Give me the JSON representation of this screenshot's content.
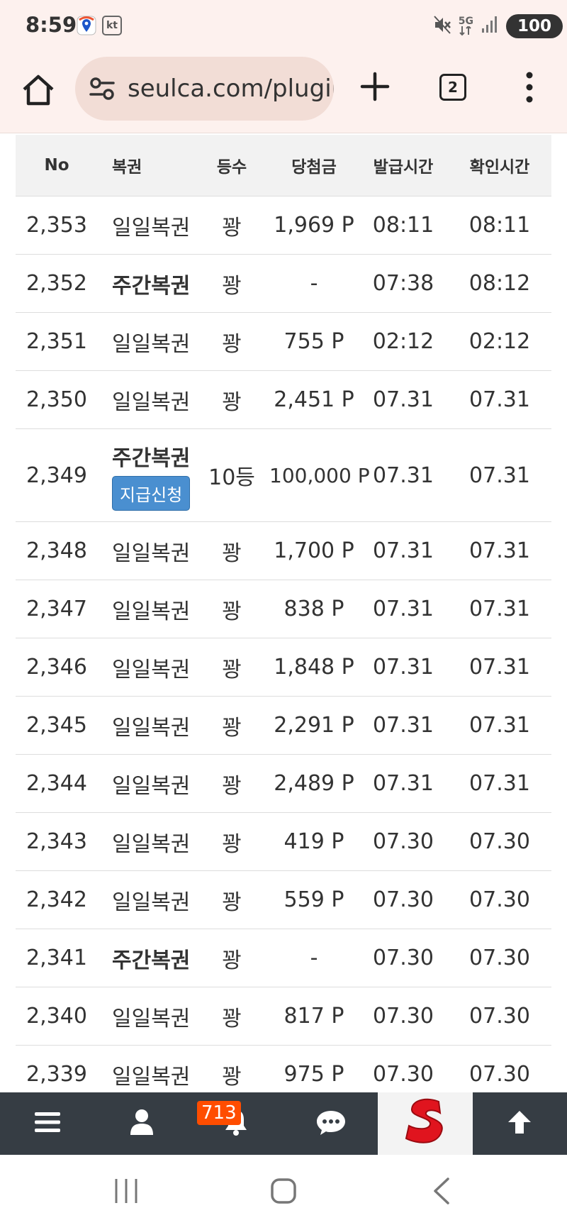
{
  "status_bar": {
    "time": "8:59",
    "carrier": "kt",
    "network": "5G",
    "battery": "100"
  },
  "browser": {
    "url": "seulca.com/plugin",
    "tab_count": "2"
  },
  "table": {
    "headers": [
      "No",
      "복권",
      "등수",
      "당첨금",
      "발급시간",
      "확인시간"
    ],
    "rows": [
      {
        "no": "2,353",
        "name": "일일복권",
        "rank": "꽝",
        "prize": "1,969 P",
        "issued": "08:11",
        "checked": "08:11"
      },
      {
        "no": "2,352",
        "name": "주간복권",
        "rank": "꽝",
        "prize": "-",
        "issued": "07:38",
        "checked": "08:12"
      },
      {
        "no": "2,351",
        "name": "일일복권",
        "rank": "꽝",
        "prize": "755 P",
        "issued": "02:12",
        "checked": "02:12"
      },
      {
        "no": "2,350",
        "name": "일일복권",
        "rank": "꽝",
        "prize": "2,451 P",
        "issued": "07.31",
        "checked": "07.31"
      },
      {
        "no": "2,349",
        "name": "주간복권",
        "rank": "10등",
        "prize": "100,000 P",
        "issued": "07.31",
        "checked": "07.31",
        "action": "지급신청"
      },
      {
        "no": "2,348",
        "name": "일일복권",
        "rank": "꽝",
        "prize": "1,700 P",
        "issued": "07.31",
        "checked": "07.31"
      },
      {
        "no": "2,347",
        "name": "일일복권",
        "rank": "꽝",
        "prize": "838 P",
        "issued": "07.31",
        "checked": "07.31"
      },
      {
        "no": "2,346",
        "name": "일일복권",
        "rank": "꽝",
        "prize": "1,848 P",
        "issued": "07.31",
        "checked": "07.31"
      },
      {
        "no": "2,345",
        "name": "일일복권",
        "rank": "꽝",
        "prize": "2,291 P",
        "issued": "07.31",
        "checked": "07.31"
      },
      {
        "no": "2,344",
        "name": "일일복권",
        "rank": "꽝",
        "prize": "2,489 P",
        "issued": "07.31",
        "checked": "07.31"
      },
      {
        "no": "2,343",
        "name": "일일복권",
        "rank": "꽝",
        "prize": "419 P",
        "issued": "07.30",
        "checked": "07.30"
      },
      {
        "no": "2,342",
        "name": "일일복권",
        "rank": "꽝",
        "prize": "559 P",
        "issued": "07.30",
        "checked": "07.30"
      },
      {
        "no": "2,341",
        "name": "주간복권",
        "rank": "꽝",
        "prize": "-",
        "issued": "07.30",
        "checked": "07.30"
      },
      {
        "no": "2,340",
        "name": "일일복권",
        "rank": "꽝",
        "prize": "817 P",
        "issued": "07.30",
        "checked": "07.30"
      },
      {
        "no": "2,339",
        "name": "일일복권",
        "rank": "꽝",
        "prize": "975 P",
        "issued": "07.30",
        "checked": "07.30"
      }
    ]
  },
  "bottom_nav": {
    "notification_count": "713",
    "items": [
      "menu-icon",
      "user-icon",
      "bell-icon",
      "chat-icon",
      "site-logo",
      "arrow-up-icon"
    ]
  },
  "colors": {
    "browser_bg": "#fdf1ee",
    "url_pill": "#f2ddd6",
    "nav_bg": "#363d44",
    "badge": "#ff4d00",
    "claim_button": "#4a8fd0",
    "logo_red": "#e0141e"
  }
}
